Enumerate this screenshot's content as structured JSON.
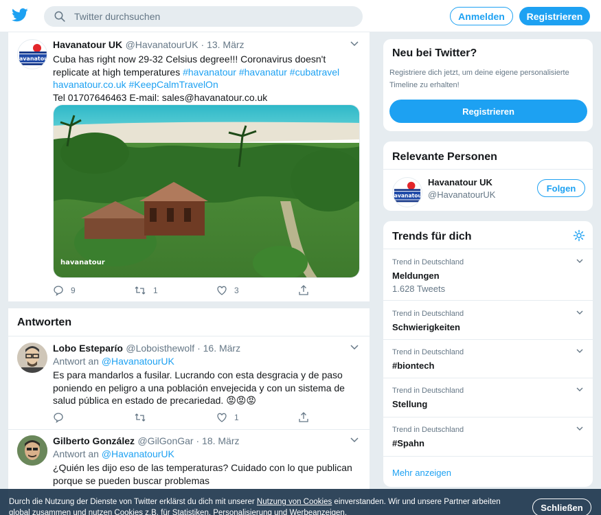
{
  "topbar": {
    "search_placeholder": "Twitter durchsuchen",
    "login_label": "Anmelden",
    "register_label": "Registrieren"
  },
  "main_tweet": {
    "name": "Havanatour UK",
    "handle_date": "@HavanatourUK · 13. März",
    "text_plain": "Cuba has right now 29-32 Celsius degree!!! Coronavirus doesn't replicate at high temperatures ",
    "hashtags": "#havanatour #havanatur #cubatravel havanatour.co.uk #KeepCalmTravelOn",
    "contact": "Tel 01707646463 E-mail: sales@havanatour.co.uk",
    "watermark": "havanatour",
    "reply_count": "9",
    "retweet_count": "1",
    "like_count": "3"
  },
  "replies_title": "Antworten",
  "reply1": {
    "name": "Lobo Esteparío",
    "handle_date": "@Loboisthewolf · 16. März",
    "reply_prefix": "Antwort an ",
    "reply_to": "@HavanatourUK",
    "text": "Es para mandarlos a fusilar. Lucrando con esta desgracia y de paso poniendo en peligro a una población envejecida y con un sistema de salud pública en estado de precariedad.",
    "emoji": "😡😡😡",
    "like_count": "1"
  },
  "reply2": {
    "name": "Gilberto González",
    "handle_date": "@GilGonGar · 18. März",
    "reply_prefix": "Antwort an ",
    "reply_to": "@HavanatourUK",
    "text": "¿Quién les dijo eso de las temperaturas? Cuidado con lo que publican porque se pueden buscar problemas"
  },
  "new_to_twitter": {
    "title": "Neu bei Twitter?",
    "text": "Registriere dich jetzt, um deine eigene personalisierte Timeline zu erhalten!",
    "button": "Registrieren"
  },
  "relevant_people": {
    "title": "Relevante Personen",
    "name": "Havanatour UK",
    "handle": "@HavanatourUK",
    "follow": "Folgen"
  },
  "trends": {
    "title": "Trends für dich",
    "items": [
      {
        "context": "Trend in Deutschland",
        "name": "Meldungen",
        "count": "1.628 Tweets"
      },
      {
        "context": "Trend in Deutschland",
        "name": "Schwierigkeiten"
      },
      {
        "context": "Trend in Deutschland",
        "name": "#biontech"
      },
      {
        "context": "Trend in Deutschland",
        "name": "Stellung"
      },
      {
        "context": "Trend in Deutschland",
        "name": "#Spahn"
      }
    ],
    "more": "Mehr anzeigen"
  },
  "cookie": {
    "text_before": "Durch die Nutzung der Dienste von Twitter erklärst du dich mit unserer ",
    "link": "Nutzung von Cookies",
    "text_after": " einverstanden. Wir und unsere Partner arbeiten global zusammen und nutzen Cookies z.B. für Statistiken, Personalisierung und Werbeanzeigen.",
    "close": "Schließen"
  },
  "colors": {
    "accent": "#1da1f2",
    "bg": "#e6ecf0",
    "muted": "#657786"
  }
}
